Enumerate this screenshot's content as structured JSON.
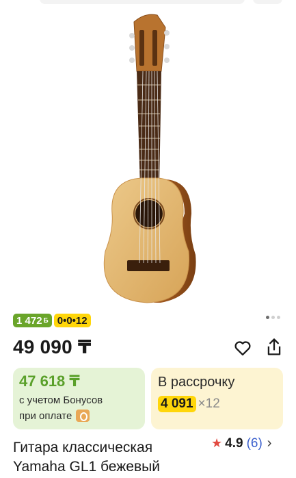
{
  "badges": {
    "bonus_value": "1 472",
    "bonus_currency": "Б",
    "installment": "0•0•12"
  },
  "price": {
    "main": "49 090 ₸"
  },
  "bonus_card": {
    "price": "47 618 ₸",
    "line1": "с учетом Бонусов",
    "line2": "при оплате"
  },
  "installment_card": {
    "title": "В рассрочку",
    "amount": "4 091",
    "multiplier": "×12"
  },
  "product": {
    "title": "Гитара классическая Yamaha GL1 бежевый"
  },
  "rating": {
    "score": "4.9",
    "count": "(6)"
  },
  "icons": {
    "favorite": "heart-outline-icon",
    "share": "share-icon",
    "rating_star": "star-icon",
    "chevron": "chevron-right-icon",
    "pay": "wallet-icon"
  },
  "colors": {
    "bonus_green": "#6aa52a",
    "installment_yellow": "#ffd60a",
    "bonus_card_bg": "#e5f3d6",
    "installment_card_bg": "#fdf4d2",
    "rating_star": "#e24b41",
    "rating_count": "#3a5fcd"
  }
}
